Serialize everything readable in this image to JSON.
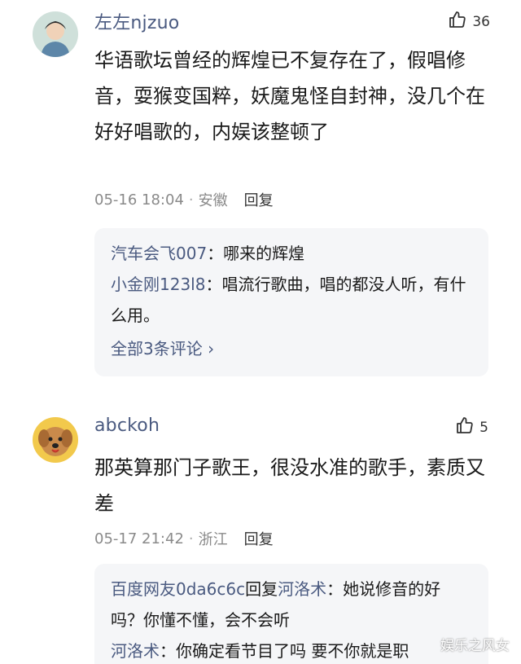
{
  "comments": [
    {
      "username": "左左njzuo",
      "likes": "36",
      "text": "华语歌坛曾经的辉煌已不复存在了，假唱修音，耍猴变国粹，妖魔鬼怪自封神，没几个在好好唱歌的，内娱该整顿了",
      "time": "05-16 18:04",
      "location": "安徽",
      "reply_label": "回复",
      "replies": [
        {
          "name": "汽车会飞007",
          "text": "：哪来的辉煌"
        },
        {
          "name": "小金刚123l8",
          "text": "：唱流行歌曲，唱的都没人听，有什么用。"
        }
      ],
      "more_label": "全部3条评论 ›"
    },
    {
      "username": "abckoh",
      "likes": "5",
      "text": "那英算那门子歌王，很没水准的歌手，素质又差",
      "time": "05-17 21:42",
      "location": "浙江",
      "reply_label": "回复",
      "replies": [
        {
          "name": "百度网友0da6c6c",
          "mid": "回复",
          "target": "河洛术",
          "text": "：她说修音的好吗？你懂不懂，会不会听"
        },
        {
          "name": "河洛术",
          "text": "：你确定看节目了吗 要不你就是职"
        }
      ]
    }
  ],
  "watermark": "娱乐之风女",
  "colors": {
    "username": "#4a5a80",
    "text": "#1a1a1a",
    "meta": "#8a8a8a",
    "reply_bg": "#f5f6f8"
  }
}
